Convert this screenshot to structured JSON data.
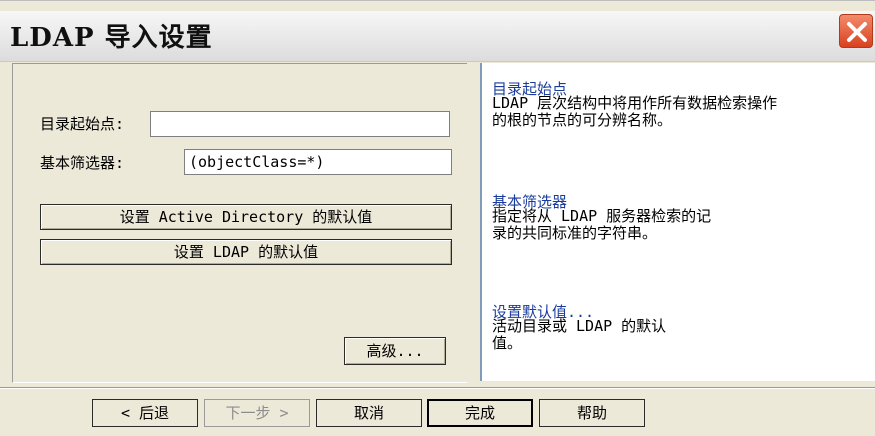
{
  "dialog": {
    "title": "LDAP 导入设置",
    "close_icon": "close-icon",
    "accent_close": "#d9411e"
  },
  "form": {
    "dir_start_label": "目录起始点:",
    "dir_start_value": "",
    "base_filter_label": "基本筛选器:",
    "base_filter_value": "(objectClass=*)",
    "ad_default_button": "设置 Active Directory 的默认值",
    "ldap_default_button": "设置 LDAP 的默认值",
    "advanced_button": "高级..."
  },
  "help": {
    "dir_start_title": "目录起始点",
    "dir_start_line1": "LDAP 层次结构中将用作所有数据检索操作",
    "dir_start_line2": "的根的节点的可分辨名称。",
    "base_filter_title": "基本筛选器",
    "base_filter_line1": "指定将从 LDAP 服务器检索的记",
    "base_filter_line2": "录的共同标准的字符串。",
    "set_default_title": "设置默认值...",
    "set_default_line1": "活动目录或 LDAP 的默认",
    "set_default_line2": "值。"
  },
  "nav": {
    "back": "< 后退",
    "next": "下一步 >",
    "cancel": "取消",
    "finish": "完成",
    "help": "帮助"
  }
}
